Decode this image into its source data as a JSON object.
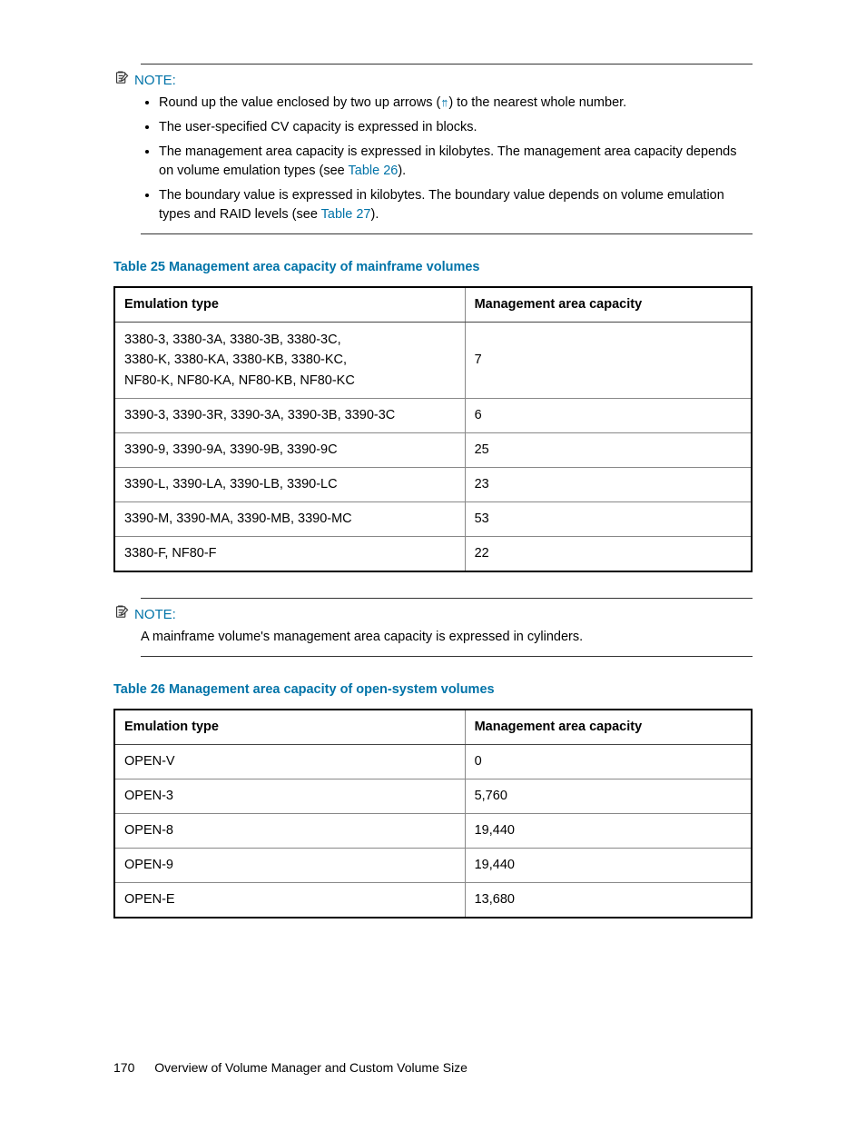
{
  "note1": {
    "label": "NOTE:",
    "bullets": [
      {
        "pre": "Round up the value enclosed by two up arrows (",
        "arrows": "↑↑",
        "post": ") to the nearest whole number."
      },
      {
        "text": "The user-specified CV capacity is expressed in blocks."
      },
      {
        "pre": "The management area capacity is expressed in kilobytes. The management area capacity depends on volume emulation types (see ",
        "link": "Table 26",
        "post": ")."
      },
      {
        "pre": "The boundary value is expressed in kilobytes. The boundary value depends on volume emulation types and RAID levels (see ",
        "link": "Table 27",
        "post": ")."
      }
    ]
  },
  "table25": {
    "caption": "Table 25 Management area capacity of mainframe volumes",
    "headers": {
      "col1": "Emulation type",
      "col2": "Management area capacity"
    },
    "rows": [
      {
        "col1_lines": [
          "3380-3, 3380-3A, 3380-3B, 3380-3C,",
          "3380-K, 3380-KA, 3380-KB, 3380-KC,",
          "NF80-K, NF80-KA, NF80-KB, NF80-KC"
        ],
        "col2": "7"
      },
      {
        "col1": "3390-3, 3390-3R, 3390-3A, 3390-3B, 3390-3C",
        "col2": "6"
      },
      {
        "col1": "3390-9, 3390-9A, 3390-9B, 3390-9C",
        "col2": "25"
      },
      {
        "col1": "3390-L, 3390-LA, 3390-LB, 3390-LC",
        "col2": "23"
      },
      {
        "col1": "3390-M, 3390-MA, 3390-MB, 3390-MC",
        "col2": "53"
      },
      {
        "col1": "3380-F, NF80-F",
        "col2": "22"
      }
    ]
  },
  "note2": {
    "label": "NOTE:",
    "text": "A mainframe volume's management area capacity is expressed in cylinders."
  },
  "table26": {
    "caption": "Table 26 Management area capacity of open-system volumes",
    "headers": {
      "col1": "Emulation type",
      "col2": "Management area capacity"
    },
    "rows": [
      {
        "col1": "OPEN-V",
        "col2": "0"
      },
      {
        "col1": "OPEN-3",
        "col2": "5,760"
      },
      {
        "col1": "OPEN-8",
        "col2": "19,440"
      },
      {
        "col1": "OPEN-9",
        "col2": "19,440"
      },
      {
        "col1": "OPEN-E",
        "col2": "13,680"
      }
    ]
  },
  "footer": {
    "page": "170",
    "title": "Overview of Volume Manager and Custom Volume Size"
  }
}
